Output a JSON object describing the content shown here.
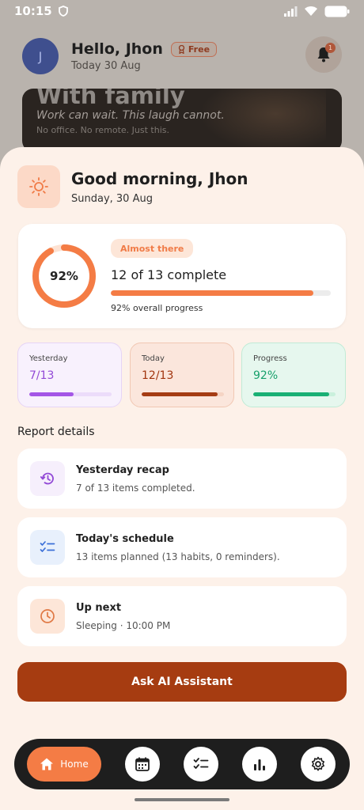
{
  "status_bar": {
    "time": "10:15"
  },
  "background": {
    "avatar_initial": "J",
    "greeting": "Hello, Jhon",
    "plan_badge": "Free",
    "date": "Today 30 Aug",
    "notification_count": "1",
    "photo_card": {
      "title": "With family",
      "subtitle": "Work can wait. This laugh cannot.",
      "caption": "No office. No remote. Just this."
    }
  },
  "sheet": {
    "greeting_title": "Good morning, Jhon",
    "greeting_date": "Sunday, 30 Aug",
    "progress_card": {
      "percent_label": "92%",
      "percent_value": 0.92,
      "badge": "Almost there",
      "complete_text": "12 of 13 complete",
      "overall_text": "92% overall progress"
    },
    "stats": [
      {
        "label": "Yesterday",
        "value": "7/13",
        "fraction": 0.54
      },
      {
        "label": "Today",
        "value": "12/13",
        "fraction": 0.92
      },
      {
        "label": "Progress",
        "value": "92%",
        "fraction": 0.92
      }
    ],
    "report_title": "Report details",
    "reports": [
      {
        "title": "Yesterday recap",
        "subtitle": "7 of 13 items completed.",
        "icon": "history-icon"
      },
      {
        "title": "Today's schedule",
        "subtitle": "13 items planned (13 habits, 0 reminders).",
        "icon": "checklist-icon"
      },
      {
        "title": "Up next",
        "subtitle": "Sleeping · 10:00 PM",
        "icon": "clock-icon"
      }
    ],
    "ask_button": "Ask AI Assistant"
  },
  "nav": {
    "home_label": "Home",
    "items": [
      "home-icon",
      "calendar-icon",
      "checklist-icon",
      "bar-chart-icon",
      "gear-icon"
    ]
  },
  "colors": {
    "accent": "#f47c45",
    "primary_dark": "#a63c11",
    "yesterday": "#a456e6",
    "progress": "#19b074"
  }
}
